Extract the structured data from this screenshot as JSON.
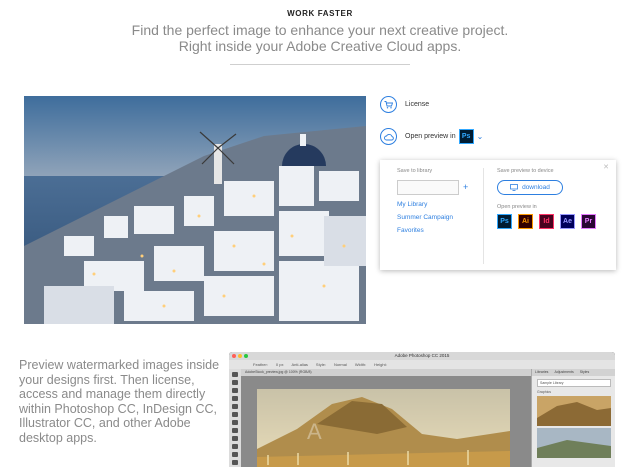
{
  "header": {
    "eyebrow": "WORK FASTER",
    "line1": "Find the perfect image to enhance your next creative project.",
    "line2": "Right inside your Adobe Creative Cloud apps."
  },
  "actions": {
    "license_label": "License",
    "license_icon": "cart-icon",
    "preview_label": "Open preview in",
    "preview_icon": "cloud-icon",
    "preview_app": "Ps"
  },
  "panel": {
    "save_to_library_label": "Save to library",
    "library_input_value": "",
    "libraries": [
      "My Library",
      "Summer Campaign",
      "Favorites"
    ],
    "save_preview_label": "Save preview to device",
    "download_label": "download",
    "open_preview_label": "Open preview in",
    "apps": [
      "Ps",
      "Ai",
      "Id",
      "Ae",
      "Pr"
    ]
  },
  "body_text": "Preview watermarked images inside your designs first. Then license, access and manage them directly within Photoshop CC, InDesign CC, Illustrator CC, and other Adobe desktop apps.",
  "photoshop": {
    "title": "Adobe Photoshop CC 2015",
    "options": [
      "Feather:",
      "0 px",
      "Anti-alias",
      "Style:",
      "Normal",
      "Width:",
      "Height:"
    ],
    "doc_tab": "AdobeStock_preview.jpg @ 100% (RGB/8)",
    "lib_tabs": [
      "Libraries",
      "Adjustments",
      "Styles"
    ],
    "lib_select": "Sample Library",
    "lib_section": "Graphics"
  },
  "colors": {
    "accent": "#2d7fe0",
    "headline_gray": "#8a8a8a"
  }
}
